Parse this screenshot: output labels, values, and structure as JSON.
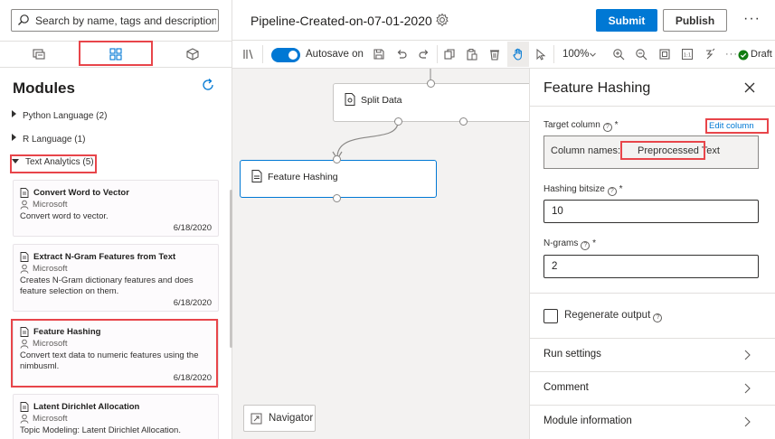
{
  "search": {
    "placeholder": "Search by name, tags and description"
  },
  "left": {
    "tabs": [
      "datasets-tab",
      "modules-tab",
      "models-tab"
    ],
    "title": "Modules",
    "categories": [
      {
        "label": "Python Language (2)",
        "expanded": false
      },
      {
        "label": "R Language (1)",
        "expanded": false
      },
      {
        "label": "Text Analytics (5)",
        "expanded": true
      }
    ],
    "cards": [
      {
        "title": "Convert Word to Vector",
        "publisher": "Microsoft",
        "desc": "Convert word to vector.",
        "date": "6/18/2020"
      },
      {
        "title": "Extract N-Gram Features from Text",
        "publisher": "Microsoft",
        "desc": "Creates N-Gram dictionary features and does feature selection on them.",
        "date": "6/18/2020"
      },
      {
        "title": "Feature Hashing",
        "publisher": "Microsoft",
        "desc": "Convert text data to numeric features using the nimbusml.",
        "date": "6/18/2020"
      },
      {
        "title": "Latent Dirichlet Allocation",
        "publisher": "Microsoft",
        "desc": "Topic Modeling: Latent Dirichlet Allocation.",
        "date": "6/18/2020"
      }
    ]
  },
  "topbar": {
    "pipeline_title": "Pipeline-Created-on-07-01-2020",
    "submit": "Submit",
    "publish": "Publish",
    "more": "···"
  },
  "toolbar": {
    "autosave_label": "Autosave on",
    "autosave_on": true,
    "zoom": "100%",
    "draft": "Draft",
    "more": "···"
  },
  "canvas": {
    "nodes": [
      {
        "label": "Split Data"
      },
      {
        "label": "Feature Hashing",
        "selected": true
      }
    ],
    "navigator": "Navigator"
  },
  "panel": {
    "title": "Feature Hashing",
    "target_column_label": "Target column",
    "required_mark": "*",
    "edit_column": "Edit column",
    "column_names_label": "Column names:",
    "column_names_value": "Preprocessed Text",
    "hashing_bitsize_label": "Hashing bitsize",
    "hashing_bitsize_value": "10",
    "ngrams_label": "N-grams",
    "ngrams_value": "2",
    "regenerate_label": "Regenerate output",
    "regenerate_checked": false,
    "sections": [
      "Run settings",
      "Comment",
      "Module information"
    ]
  },
  "colors": {
    "accent": "#0078d4",
    "highlight": "#e8454a",
    "draft_ok": "#107c10"
  }
}
